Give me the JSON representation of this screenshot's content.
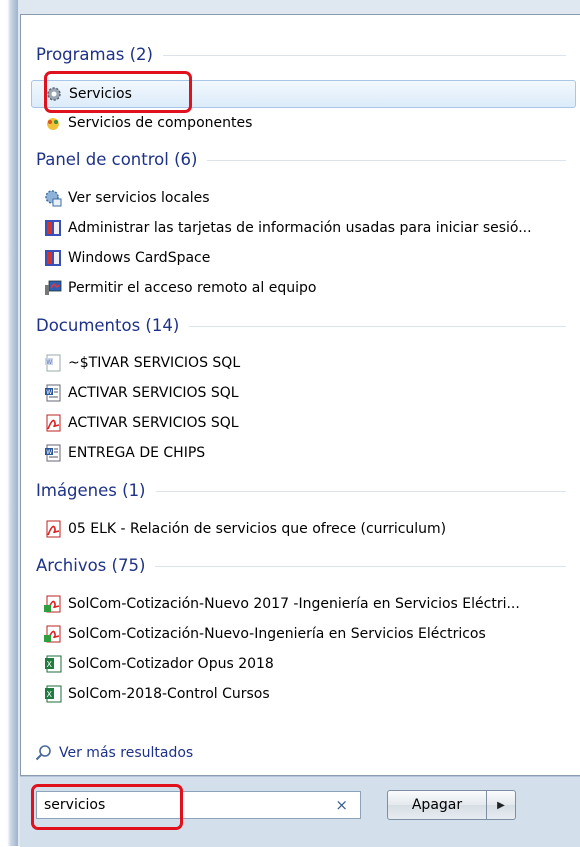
{
  "groups": {
    "programs": {
      "title": "Programas (2)",
      "items": [
        "Servicios",
        "Servicios de componentes"
      ]
    },
    "control_panel": {
      "title": "Panel de control (6)",
      "items": [
        "Ver servicios locales",
        "Administrar las tarjetas de información usadas para iniciar sesió...",
        "Windows CardSpace",
        "Permitir el acceso remoto al equipo"
      ]
    },
    "documents": {
      "title": "Documentos (14)",
      "items": [
        "~$TIVAR SERVICIOS SQL",
        "ACTIVAR SERVICIOS SQL",
        "ACTIVAR SERVICIOS SQL",
        "ENTREGA DE CHIPS"
      ]
    },
    "images": {
      "title": "Imágenes (1)",
      "items": [
        "05 ELK - Relación de servicios que ofrece (curriculum)"
      ]
    },
    "files": {
      "title": "Archivos (75)",
      "items": [
        "SolCom-Cotización-Nuevo 2017 -Ingeniería en Servicios Eléctri...",
        "SolCom-Cotización-Nuevo-Ingeniería en Servicios Eléctricos",
        "SolCom-Cotizador Opus 2018",
        "SolCom-2018-Control Cursos"
      ]
    }
  },
  "more_results": "Ver más resultados",
  "search": {
    "value": "servicios",
    "clear": "×"
  },
  "shutdown": {
    "label": "Apagar",
    "arrow": "▶"
  },
  "colors": {
    "group_title": "#1e3287",
    "highlight": "#e0101c",
    "selection": "#dcebfa"
  }
}
